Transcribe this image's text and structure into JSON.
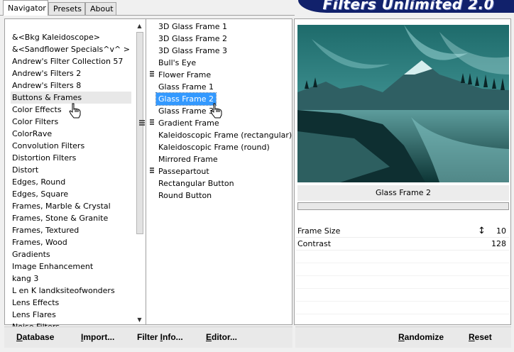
{
  "tabs": [
    {
      "label": "Navigator",
      "active": true
    },
    {
      "label": "Presets",
      "active": false
    },
    {
      "label": "About",
      "active": false
    }
  ],
  "brand": {
    "title": "Filters Unlimited 2.0",
    "color": "#11216b"
  },
  "categories": [
    "&<Bkg Kaleidoscope>",
    "&<Sandflower Specials^v^ >",
    "Andrew's Filter Collection 57",
    "Andrew's Filters 2",
    "Andrew's Filters 8",
    "Buttons & Frames",
    "Color Effects",
    "Color Filters",
    "ColorRave",
    "Convolution Filters",
    "Distortion Filters",
    "Distort",
    "Edges, Round",
    "Edges, Square",
    "Frames, Marble & Crystal",
    "Frames, Stone & Granite",
    "Frames, Textured",
    "Frames, Wood",
    "Gradients",
    "Image Enhancement",
    "kang 3",
    "L en K landksiteofwonders",
    "Lens Effects",
    "Lens Flares",
    "Noise Filters"
  ],
  "selected_category": "Buttons & Frames",
  "filters": [
    {
      "label": "3D Glass Frame 1",
      "grip": false
    },
    {
      "label": "3D Glass Frame 2",
      "grip": false
    },
    {
      "label": "3D Glass Frame 3",
      "grip": false
    },
    {
      "label": "Bull's Eye",
      "grip": false
    },
    {
      "label": "Flower Frame",
      "grip": true
    },
    {
      "label": "Glass Frame 1",
      "grip": false
    },
    {
      "label": "Glass Frame 2",
      "grip": false
    },
    {
      "label": "Glass Frame 3",
      "grip": false
    },
    {
      "label": "Gradient Frame",
      "grip": true
    },
    {
      "label": "Kaleidoscopic Frame (rectangular)",
      "grip": false
    },
    {
      "label": "Kaleidoscopic Frame (round)",
      "grip": false
    },
    {
      "label": "Mirrored Frame",
      "grip": false
    },
    {
      "label": "Passepartout",
      "grip": true
    },
    {
      "label": "Rectangular Button",
      "grip": false
    },
    {
      "label": "Round Button",
      "grip": false
    }
  ],
  "selected_filter": "Glass Frame 2",
  "preview": {
    "caption": "Glass Frame 2"
  },
  "params": [
    {
      "label": "Frame Size",
      "value": "10"
    },
    {
      "label": "Contrast",
      "value": "128"
    }
  ],
  "bottom_left": {
    "database": {
      "underline": "D",
      "rest": "atabase"
    },
    "import": {
      "underline": "I",
      "rest": "mport..."
    },
    "filter_info": {
      "pre": "Filter ",
      "underline": "I",
      "rest": "nfo..."
    },
    "editor": {
      "underline": "E",
      "rest": "ditor..."
    }
  },
  "bottom_right": {
    "randomize": {
      "underline": "R",
      "rest": "andomize"
    },
    "reset": {
      "underline": "R",
      "rest": "eset"
    }
  },
  "colors": {
    "selection": "#3399ff",
    "accent_dark": "#11216b"
  }
}
